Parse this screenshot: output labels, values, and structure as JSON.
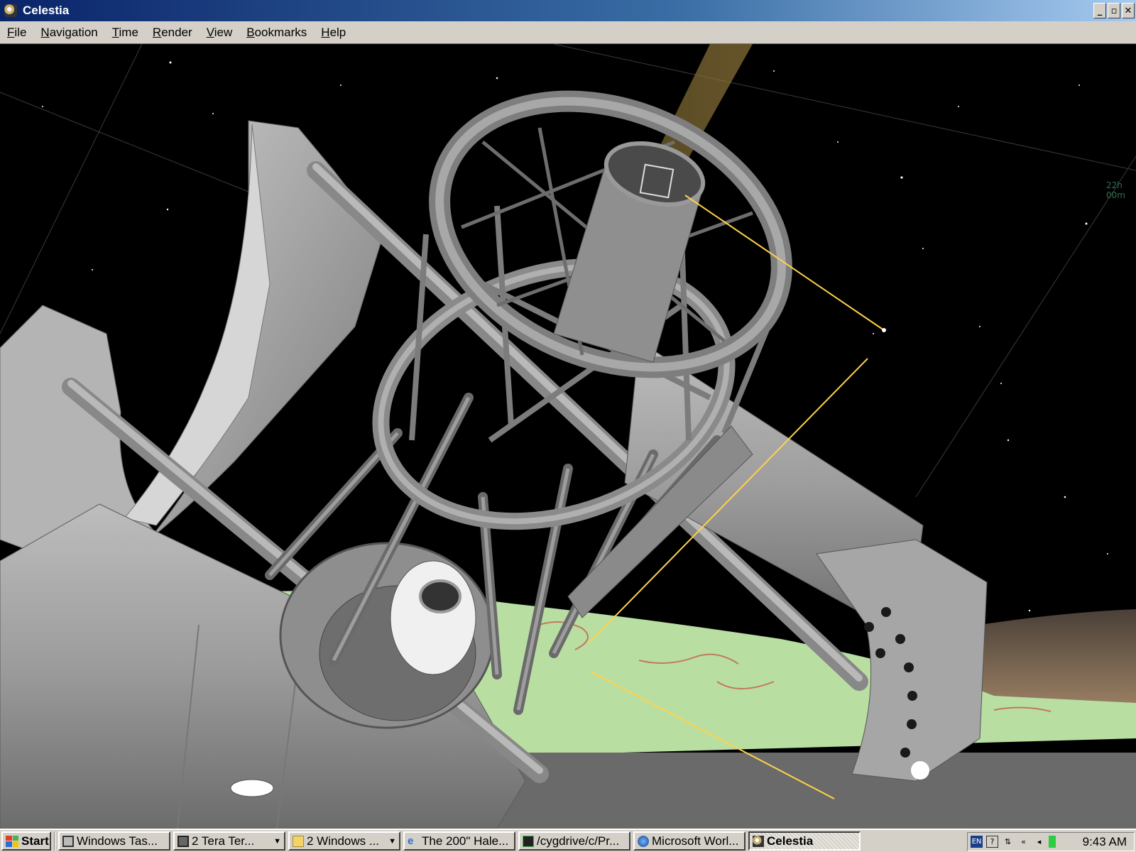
{
  "window": {
    "title": "Celestia",
    "buttons": {
      "minimize": "_",
      "restore": "▫",
      "close": "✕"
    }
  },
  "menu": [
    "File",
    "Navigation",
    "Time",
    "Render",
    "View",
    "Bookmarks",
    "Help"
  ],
  "viewport": {
    "grid_label": "22h 00m"
  },
  "taskbar": {
    "start_label": "Start",
    "tasks": [
      {
        "label": "Windows Tas...",
        "icon": "computer-icon",
        "active": false,
        "group": false
      },
      {
        "label": "2 Tera Ter...",
        "icon": "terminal-icon",
        "active": false,
        "group": true
      },
      {
        "label": "2 Windows ...",
        "icon": "folder-icon",
        "active": false,
        "group": true
      },
      {
        "label": "The 200\" Hale...",
        "icon": "ie-icon",
        "active": false,
        "group": false
      },
      {
        "label": "/cygdrive/c/Pr...",
        "icon": "cygwin-icon",
        "active": false,
        "group": false
      },
      {
        "label": "Microsoft Worl...",
        "icon": "worldwide-telescope-icon",
        "active": false,
        "group": false
      },
      {
        "label": "Celestia",
        "icon": "celestia-icon",
        "active": true,
        "group": false
      }
    ],
    "tray": {
      "language": "EN",
      "clock": "9:43 AM"
    }
  },
  "colors": {
    "titlebar_start": "#0a246a",
    "titlebar_end": "#a6caf0",
    "chrome": "#d4d0c8",
    "sky": "#000000",
    "telescope": "#9a9a9a",
    "terrain": "#b8dca0",
    "laser": "#ffd24a"
  }
}
